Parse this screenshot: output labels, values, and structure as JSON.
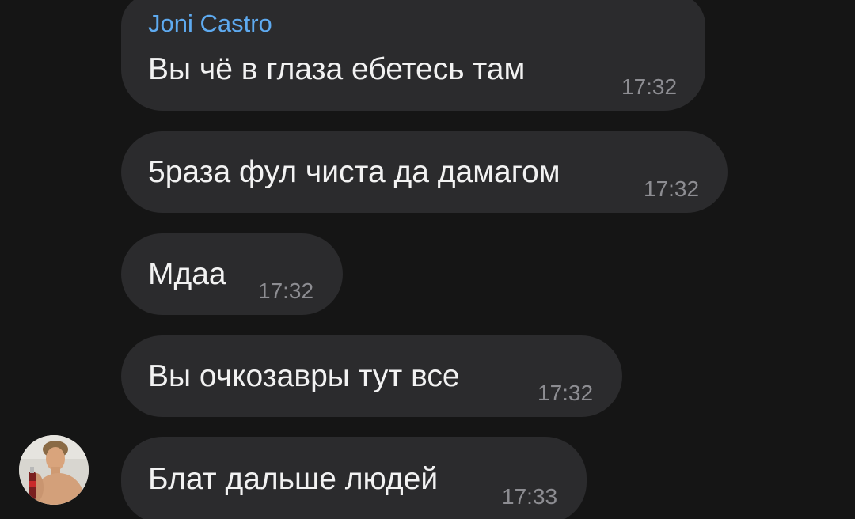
{
  "messages": [
    {
      "sender": "Joni Castro",
      "text": "Вы чё в глаза ебетесь там",
      "time": "17:32"
    },
    {
      "text": "5раза фул чиста да дамагом",
      "time": "17:32"
    },
    {
      "text": "Мдаа",
      "time": "17:32"
    },
    {
      "text": "Вы очкозавры тут все",
      "time": "17:32"
    },
    {
      "text": "Блат дальше людей",
      "time": "17:33"
    }
  ],
  "colors": {
    "background": "#151515",
    "bubble": "#2b2b2d",
    "sender_name": "#5eaaf0",
    "text": "#f2f2f2",
    "time": "#8d8d92"
  }
}
